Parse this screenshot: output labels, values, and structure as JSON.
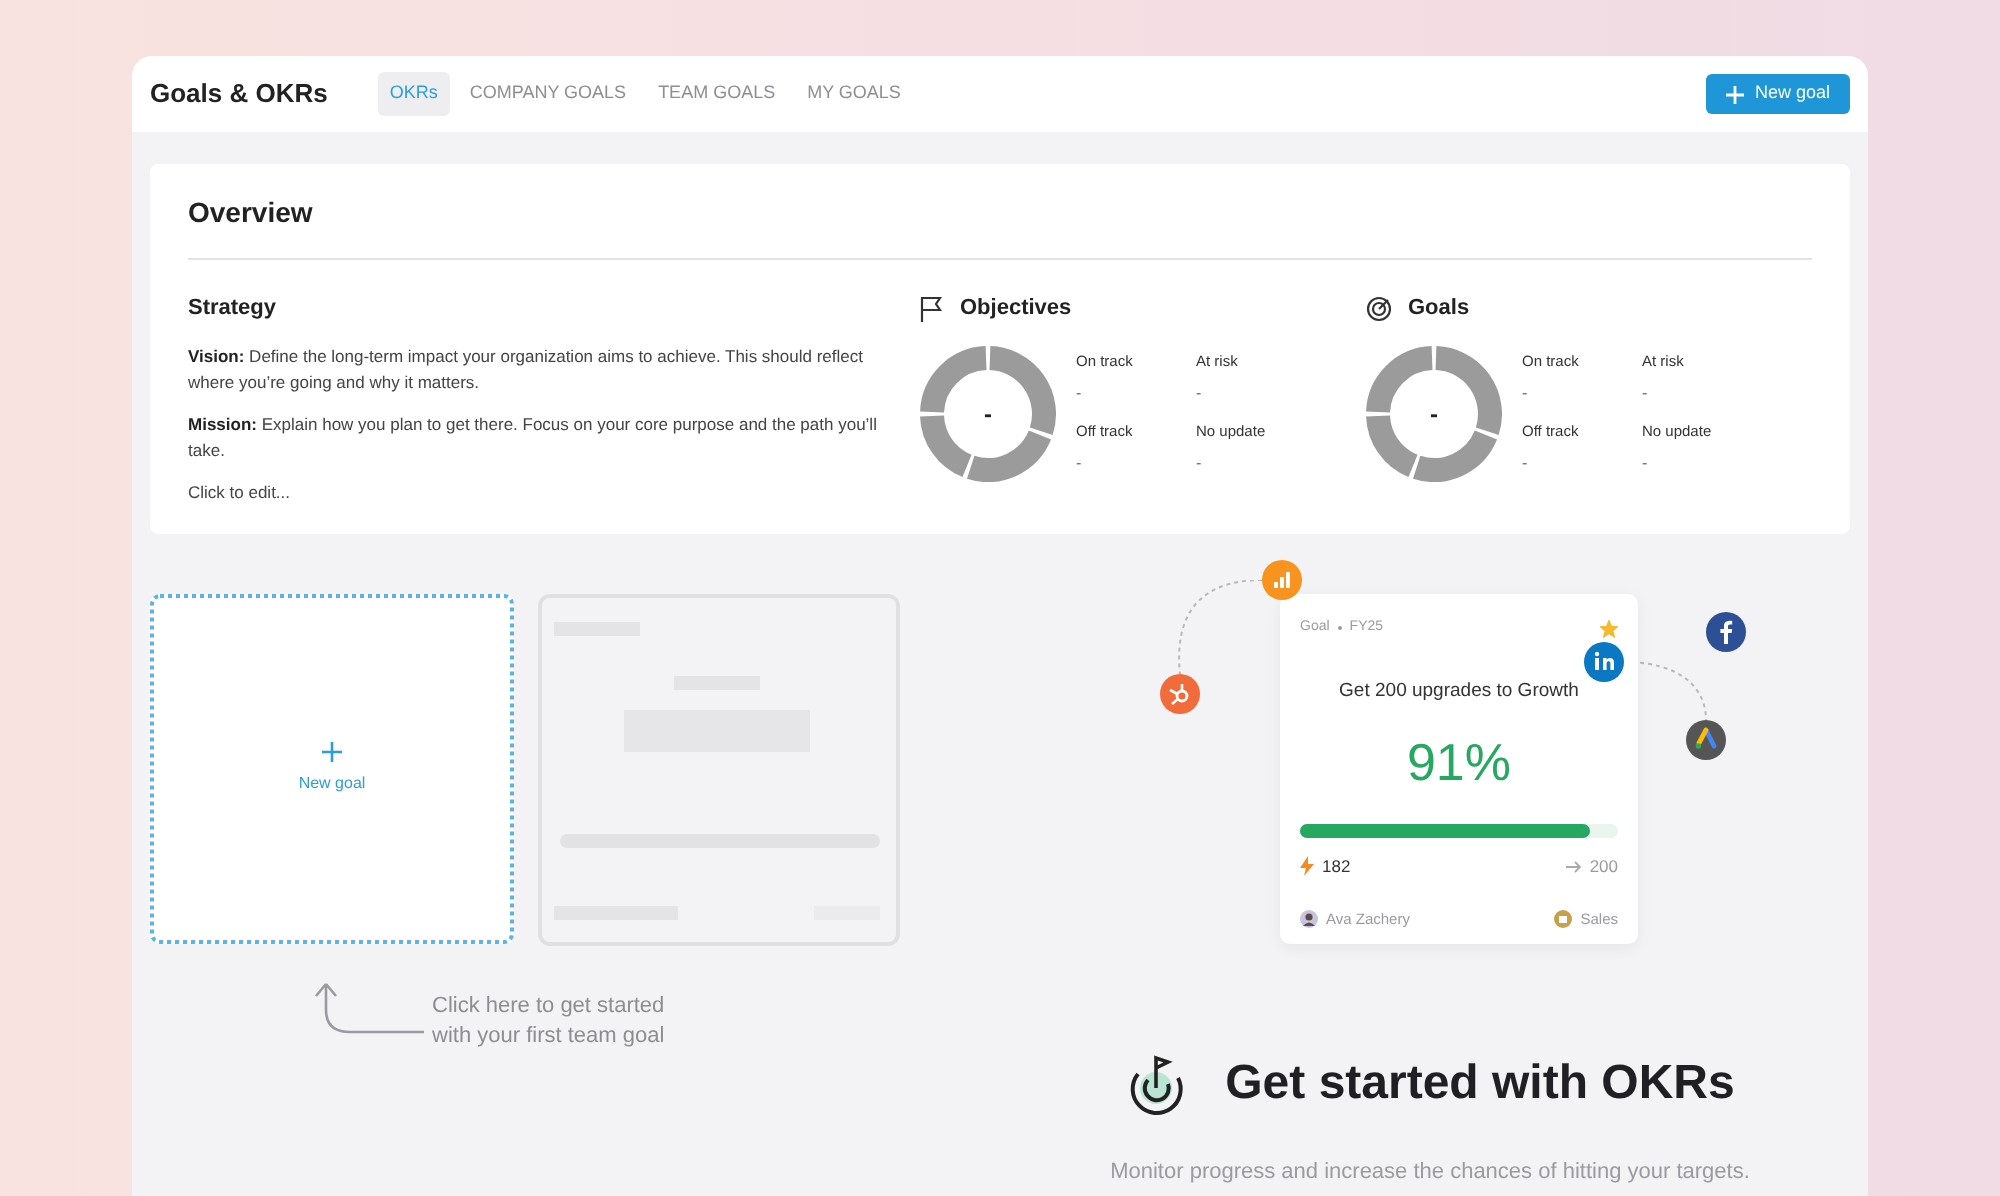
{
  "header": {
    "title": "Goals & OKRs",
    "tabs": [
      {
        "label": "OKRs",
        "selected": true
      },
      {
        "label": "COMPANY GOALS",
        "selected": false
      },
      {
        "label": "TEAM GOALS",
        "selected": false
      },
      {
        "label": "MY GOALS",
        "selected": false
      }
    ],
    "new_goal_button": "New goal"
  },
  "overview": {
    "title": "Overview",
    "strategy": {
      "title": "Strategy",
      "paragraphs": [
        "**Vision:** Define the long-term impact your organization aims to achieve. This should reflect where you’re going and why it matters.",
        "**Mission:** Explain how you plan to get there. Focus on your core purpose and the path you’ll take."
      ],
      "edit_hint": "Click to edit..."
    },
    "panels": [
      {
        "kind": "objectives",
        "title": "Objectives",
        "center_value": "-",
        "stats": [
          {
            "label": "On track",
            "value": "-"
          },
          {
            "label": "At risk",
            "value": "-"
          },
          {
            "label": "Off track",
            "value": "-"
          },
          {
            "label": "No update",
            "value": "-"
          }
        ]
      },
      {
        "kind": "goals",
        "title": "Goals",
        "center_value": "-",
        "stats": [
          {
            "label": "On track",
            "value": "-"
          },
          {
            "label": "At risk",
            "value": "-"
          },
          {
            "label": "Off track",
            "value": "-"
          },
          {
            "label": "No update",
            "value": "-"
          }
        ]
      }
    ]
  },
  "new_goal_card": {
    "label": "New goal"
  },
  "hint_lines": [
    "Click here to get started",
    "with your first team goal"
  ],
  "example_card": {
    "type": "Goal",
    "period": "FY25",
    "starred": true,
    "title": "Get 200 upgrades to Growth",
    "percent": "91%",
    "level": 0.91,
    "current": "182",
    "target": "200",
    "owner": "Ava Zachery",
    "team": "Sales"
  },
  "get_started": {
    "title": "Get started with OKRs",
    "subtitle": "Monitor progress and increase the chances of hitting your targets."
  }
}
